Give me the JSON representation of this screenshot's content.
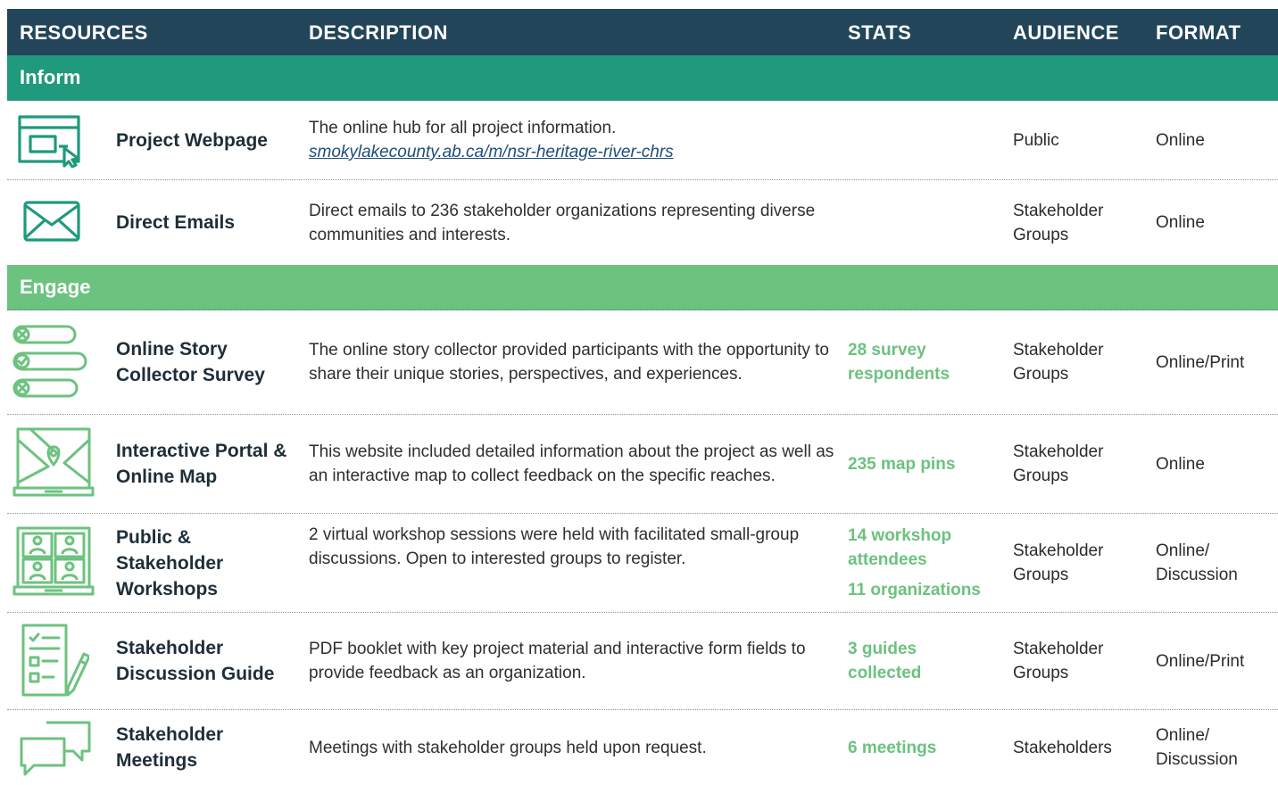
{
  "header": {
    "resources": "RESOURCES",
    "description": "DESCRIPTION",
    "stats": "STATS",
    "audience": "AUDIENCE",
    "format": "FORMAT"
  },
  "colors": {
    "header_bg": "#22455a",
    "inform_band": "#1f9a7c",
    "engage_band": "#6cc27f",
    "stats_text": "#6cc27f"
  },
  "sections": [
    {
      "label": "Inform",
      "rows": [
        {
          "icon": "webpage-cursor-icon",
          "name": "Project Webpage",
          "description": "The online hub for all project information.",
          "link": "smokylakecounty.ab.ca/m/nsr-heritage-river-chrs",
          "stats": [],
          "audience": "Public",
          "format": "Online"
        },
        {
          "icon": "envelope-icon",
          "name": "Direct Emails",
          "description": "Direct emails to 236 stakeholder organizations representing diverse communities and interests.",
          "stats": [],
          "audience": "Stakeholder Groups",
          "format": "Online"
        }
      ]
    },
    {
      "label": "Engage",
      "rows": [
        {
          "icon": "survey-checklist-icon",
          "name": "Online Story Collector Survey",
          "description": "The online story collector provided participants with the opportunity to share their unique stories, perspectives, and experiences.",
          "stats": [
            "28 survey respondents"
          ],
          "audience": "Stakeholder Groups",
          "format": "Online/Print"
        },
        {
          "icon": "laptop-map-pin-icon",
          "name": "Interactive Portal & Online Map",
          "description": "This website included detailed information about the project as well as an interactive map to collect feedback on the specific reaches.",
          "stats": [
            "235 map pins"
          ],
          "audience": "Stakeholder Groups",
          "format": "Online"
        },
        {
          "icon": "laptop-video-meeting-icon",
          "name": "Public & Stakeholder Workshops",
          "description": "2 virtual workshop sessions were held with facilitated small-group discussions. Open to interested groups to register.",
          "stats": [
            "14 workshop attendees",
            "11 organizations"
          ],
          "audience": "Stakeholder Groups",
          "format": "Online/ Discussion"
        },
        {
          "icon": "document-pencil-icon",
          "name": "Stakeholder Discussion Guide",
          "description": "PDF booklet with key project material and interactive form fields to provide feedback as an organization.",
          "stats": [
            "3 guides collected"
          ],
          "audience": "Stakeholder Groups",
          "format": "Online/Print"
        },
        {
          "icon": "speech-bubbles-icon",
          "name": "Stakeholder Meetings",
          "description": "Meetings with stakeholder groups held upon request.",
          "stats": [
            "6 meetings"
          ],
          "audience": "Stakeholders",
          "format": "Online/ Discussion"
        }
      ]
    }
  ]
}
